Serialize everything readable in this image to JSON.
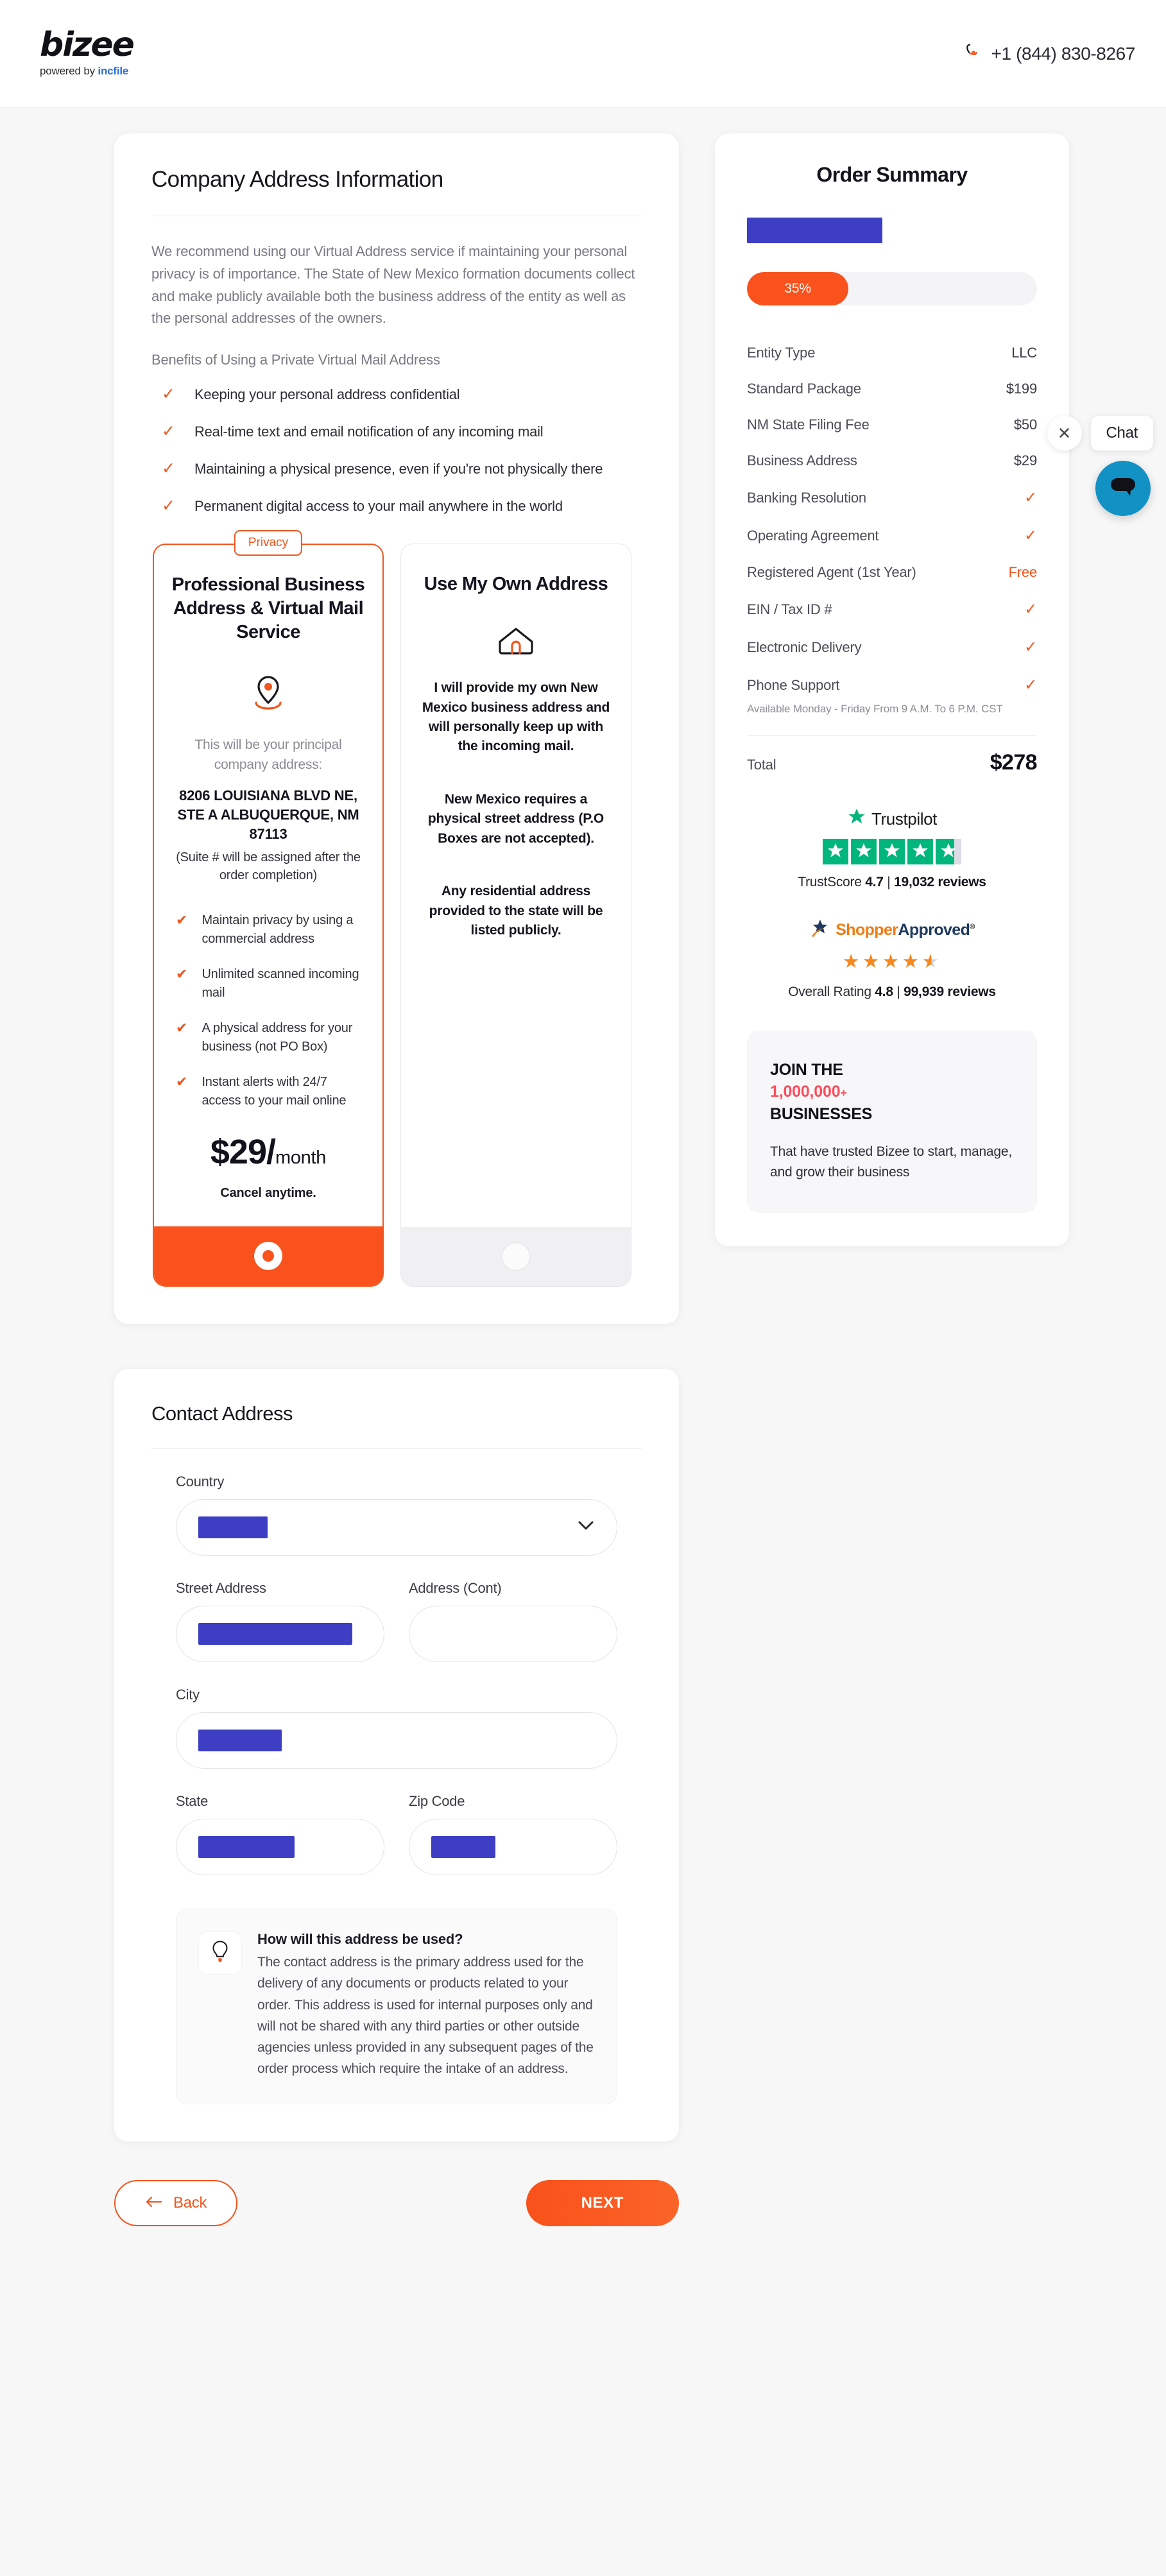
{
  "header": {
    "logo_main": "bizee",
    "logo_sub_prefix": "powered by ",
    "logo_sub_brand": "incfile",
    "phone": "+1 (844) 830-8267"
  },
  "main": {
    "title": "Company Address Information",
    "lead": "We recommend using our Virtual Address service if maintaining your personal privacy is of importance. The State of New Mexico formation documents collect and make publicly available both the business address of the entity as well as the personal addresses of the owners.",
    "benefits_title": "Benefits of Using a Private Virtual Mail Address",
    "benefits": [
      "Keeping your personal address confidential",
      "Real-time text and email notification of any incoming mail",
      "Maintaining a physical presence, even if you're not physically there",
      "Permanent digital access to your mail anywhere in the world"
    ]
  },
  "option_virtual": {
    "ribbon": "Privacy",
    "title": "Professional Business Address & Virtual Mail Service",
    "subtitle": "This will be your principal company address:",
    "address": "8206 LOUISIANA BLVD NE, STE A ALBUQUERQUE, NM 87113",
    "note": "(Suite # will be assigned after the order completion)",
    "features": [
      "Maintain privacy by using a commercial address",
      "Unlimited scanned incoming mail",
      "A physical address for your business (not PO Box)",
      "Instant alerts with 24/7 access to your mail online"
    ],
    "price_amount": "$29/",
    "price_period": "month",
    "cancel": "Cancel anytime.",
    "selected": true
  },
  "option_own": {
    "title": "Use My Own Address",
    "paragraph_1": "I will provide my own New Mexico business address and will personally keep up with the incoming mail.",
    "paragraph_2": "New Mexico requires a physical street address (P.O Boxes are not accepted).",
    "paragraph_3": "Any residential address provided to the state will be listed publicly.",
    "selected": false
  },
  "summary": {
    "title": "Order Summary",
    "company_name_redacted": true,
    "progress_label": "35%",
    "progress_value": 35,
    "rows": [
      {
        "label": "Entity Type",
        "value": "LLC",
        "type": "text"
      },
      {
        "label": "Standard Package",
        "value": "$199",
        "type": "text"
      },
      {
        "label": "NM State Filing Fee",
        "value": "$50",
        "type": "text"
      },
      {
        "label": "Business Address",
        "value": "$29",
        "type": "text"
      },
      {
        "label": "Banking Resolution",
        "value": "✓",
        "type": "check"
      },
      {
        "label": "Operating Agreement",
        "value": "✓",
        "type": "check"
      },
      {
        "label": "Registered Agent (1st Year)",
        "value": "Free",
        "type": "free"
      },
      {
        "label": "EIN / Tax ID #",
        "value": "✓",
        "type": "check"
      },
      {
        "label": "Electronic Delivery",
        "value": "✓",
        "type": "check"
      },
      {
        "label": "Phone Support",
        "value": "✓",
        "type": "check"
      }
    ],
    "phone_support_note": "Available Monday - Friday From 9 A.M. To 6 P.M. CST",
    "total_label": "Total",
    "total_value": "$278"
  },
  "trustpilot": {
    "name": "Trustpilot",
    "stars": 4.7,
    "score_text": "TrustScore 4.7 | 19,032 reviews",
    "score_prefix": "TrustScore ",
    "score_value": "4.7",
    "divider": " | ",
    "reviews": "19,032 reviews"
  },
  "shopper_approved": {
    "name_part1": "Shopper",
    "name_part2": "Approved",
    "stars": 4.5,
    "rating_prefix": "Overall Rating ",
    "rating_value": "4.8",
    "divider": " | ",
    "reviews": "99,939 reviews"
  },
  "join_box": {
    "line1": "JOIN THE",
    "line2": "1,000,000",
    "line2_plus": "+",
    "line3": "BUSINESSES",
    "body": "That have trusted Bizee to start, manage, and grow their business"
  },
  "contact": {
    "title": "Contact Address",
    "country_label": "Country",
    "country_value_redacted": true,
    "street_label": "Street Address",
    "street_value_redacted": true,
    "address_cont_label": "Address (Cont)",
    "address_cont_value": "",
    "city_label": "City",
    "city_value_redacted": true,
    "state_label": "State",
    "state_value_redacted": true,
    "zip_label": "Zip Code",
    "zip_value_redacted": true,
    "info_title": "How will this address be used?",
    "info_body": "The contact address is the primary address used for the delivery of any documents or products related to your order. This address is used for internal purposes only and will not be shared with any third parties or other outside agencies unless provided in any subsequent pages of the order process which require the intake of an address."
  },
  "nav": {
    "back_label": "Back",
    "next_label": "NEXT"
  },
  "chat": {
    "label": "Chat"
  },
  "colors": {
    "accent_orange": "#f2551d",
    "cta_orange": "#f9521c",
    "trustpilot_green": "#00b67a",
    "shopper_orange": "#f07d16",
    "shopper_navy": "#1e3a5f",
    "join_red": "#fd4d5c",
    "chat_blue": "#1291c4",
    "redaction_blue": "#3d3ec4"
  }
}
